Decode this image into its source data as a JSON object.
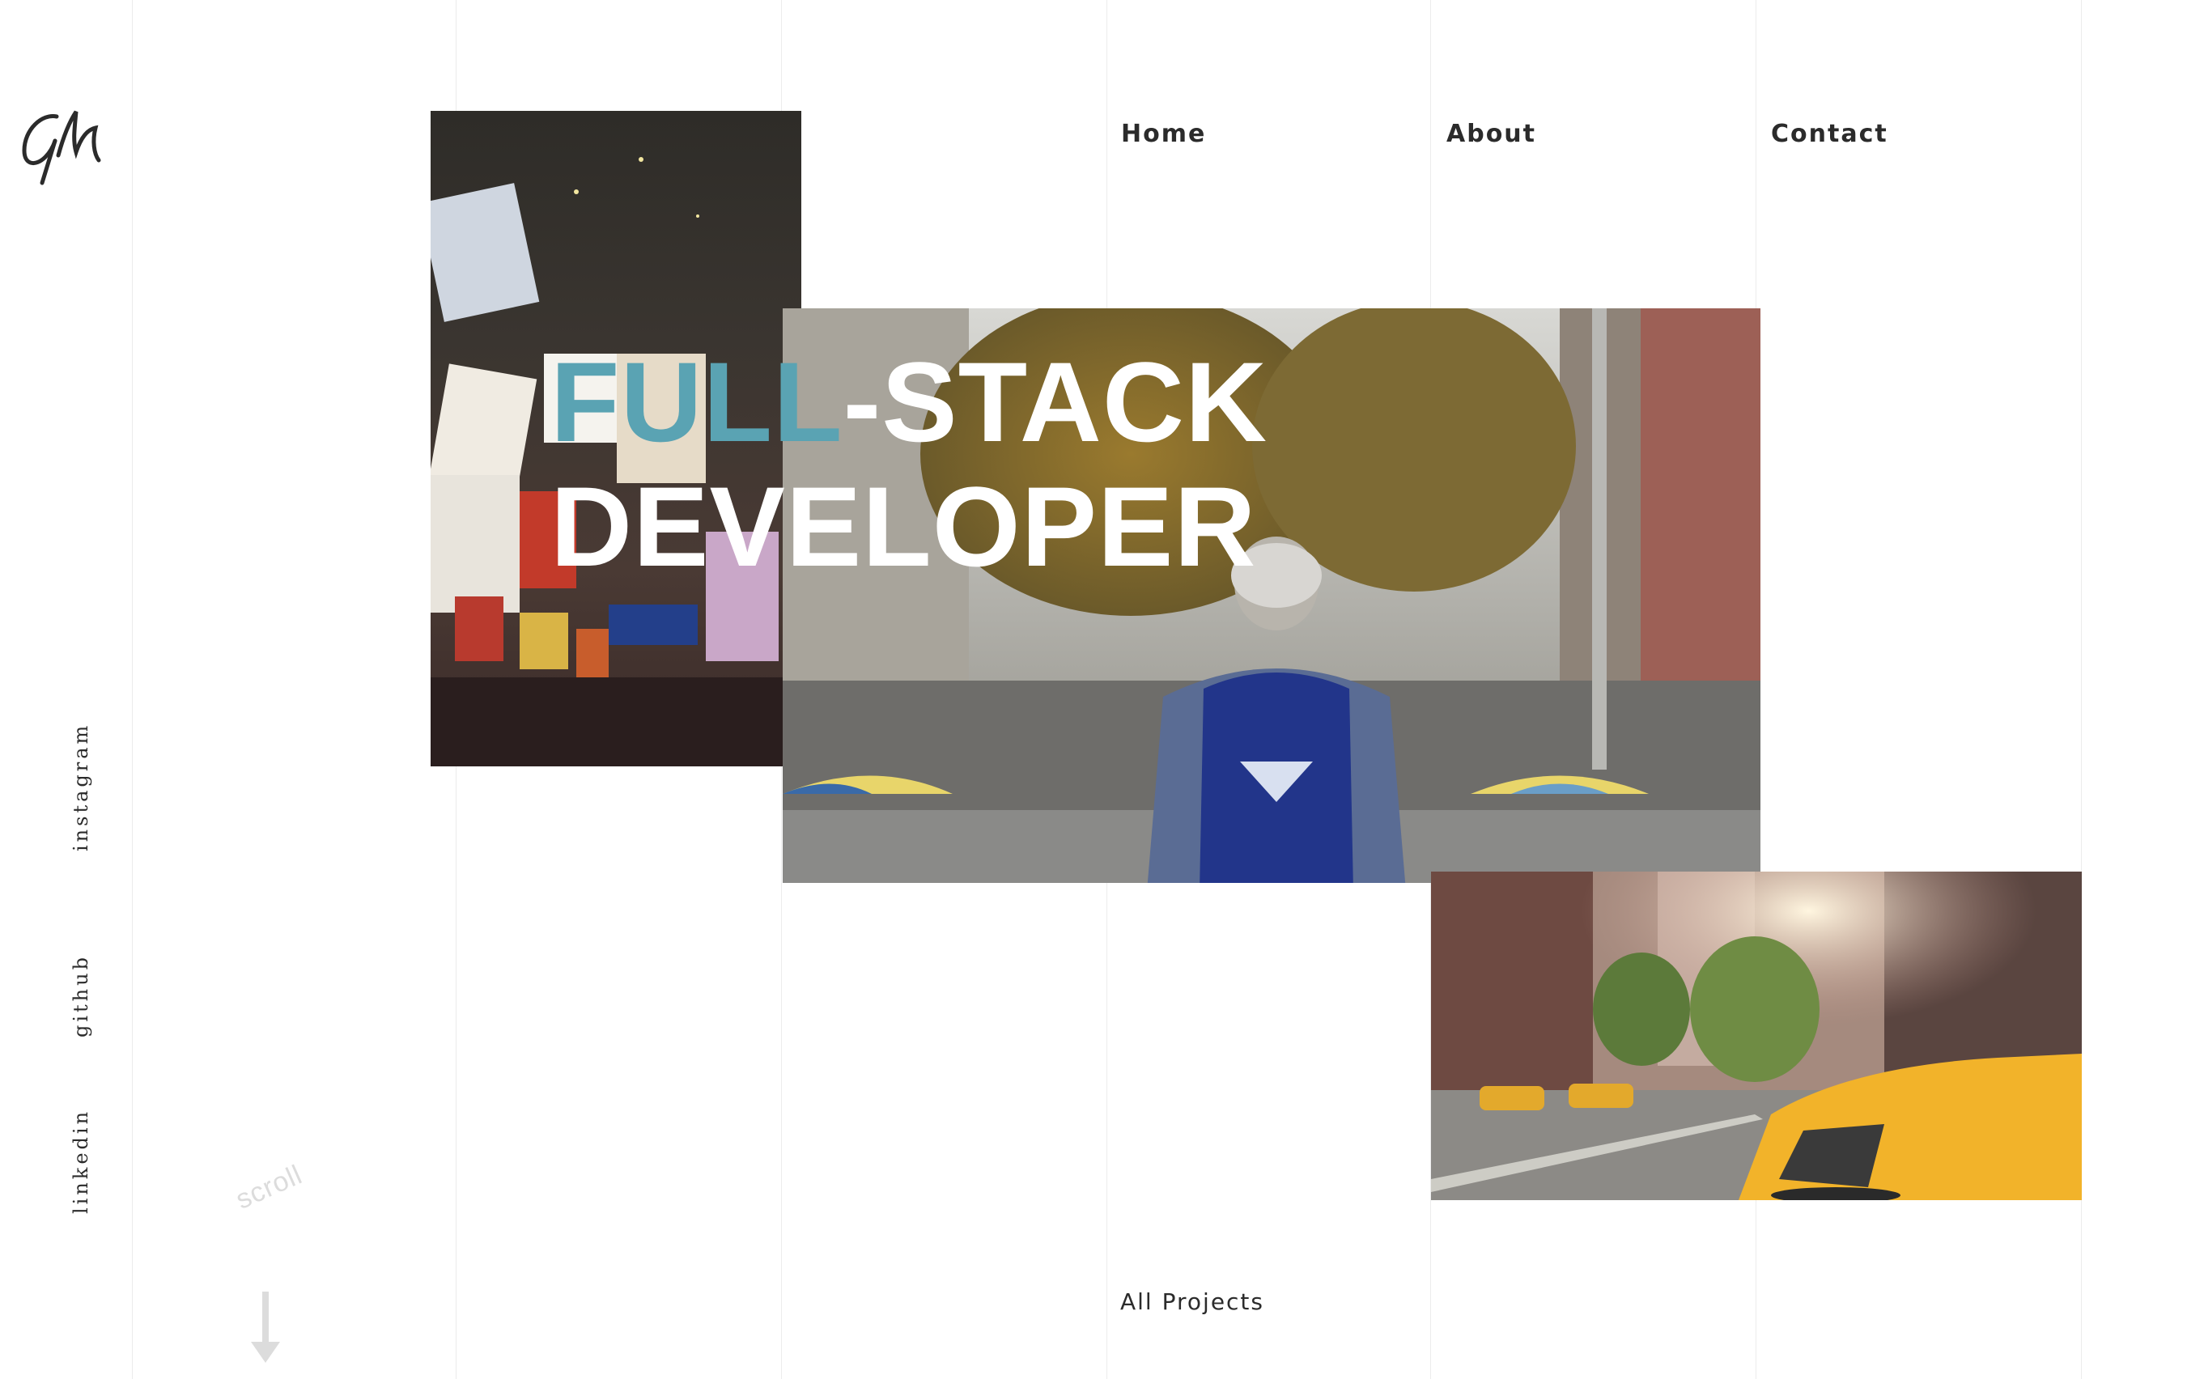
{
  "logo": {
    "initials": "GM",
    "icon": "signature-logo"
  },
  "nav": {
    "home": "Home",
    "about": "About",
    "contact": "Contact"
  },
  "hero": {
    "title_accent": "FULL",
    "title_rest": "-STACK",
    "title_line2": "DEVELOPER",
    "accent_color": "#5aa3b3"
  },
  "images": {
    "times_square": "times-square-night-photo",
    "backpacker": "man-with-backpack-city-street-photo",
    "taxi": "yellow-taxi-city-street-photo"
  },
  "social": {
    "instagram": "instagram",
    "github": "github",
    "linkedin": "linkedin"
  },
  "scroll": {
    "label": "scroll",
    "icon": "arrow-down-icon"
  },
  "projects": {
    "all_label": "All Projects"
  }
}
